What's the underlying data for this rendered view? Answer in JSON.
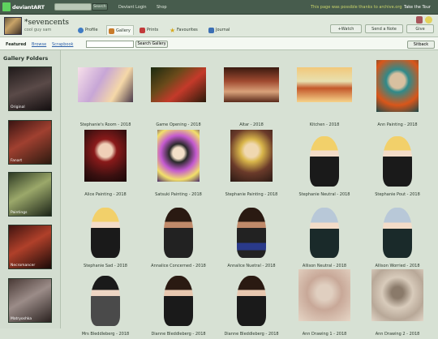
{
  "topbar": {
    "logo_text": "deviantART",
    "search_button": "Search",
    "nav": [
      "Deviant Login",
      "Shop"
    ],
    "ad_text": "This page was possible thanks to archive.org",
    "tour": "Take the Tour"
  },
  "profile": {
    "username": "*sevencents",
    "tagline": "cool guy sam"
  },
  "tabs": [
    "Profile",
    "Gallery",
    "Prints",
    "Favourites",
    "Journal"
  ],
  "actions": {
    "watch": "+Watch",
    "note": "Send a Note",
    "give": "Give"
  },
  "toolbar": {
    "featured": "Featured",
    "browse": "Browse",
    "scrapbook": "Scrapbook",
    "search_button": "Search Gallery",
    "sitback": "Sitback"
  },
  "sidebar": {
    "title": "Gallery Folders",
    "folders": [
      "Original",
      "Fanart",
      "Paintings",
      "Necromancer",
      "Matryoshka"
    ]
  },
  "gallery": {
    "items": [
      "Stephanie's Room - 2018",
      "Game Opening - 2018",
      "Altar - 2018",
      "Kitchen - 2018",
      "Ann Painting - 2018",
      "Alice Painting - 2018",
      "Satsuki Painting - 2018",
      "Stephanie Painting - 2018",
      "Stephanie Neutral - 2018",
      "Stephanie Pout - 2018",
      "Stephanie Sad - 2018",
      "Annalice Concerned - 2018",
      "Annalice Nuetral - 2018",
      "Allison Neutral - 2018",
      "Allison Worried - 2018",
      "Mrs Bleddleberg - 2018",
      "Dianne Bleddleberg - 2018",
      "Dianne Bleddleberg - 2018",
      "Ann Drawing 1 - 2018",
      "Ann Drawing 2 - 2018"
    ]
  },
  "colors": {
    "brand": "#5fd15f",
    "topbar": "#475c4d",
    "page": "#d7e1d4"
  }
}
